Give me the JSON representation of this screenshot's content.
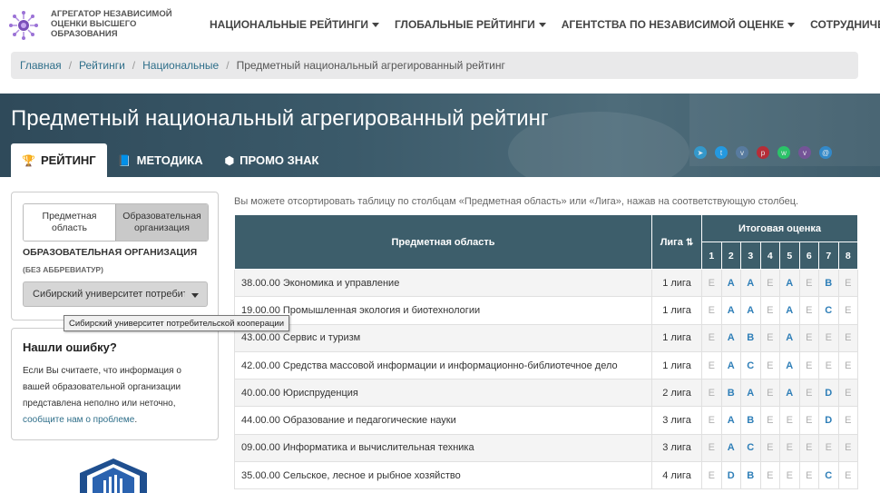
{
  "header": {
    "logo_text": "АГРЕГАТОР НЕЗАВИСИМОЙ ОЦЕНКИ ВЫСШЕГО ОБРАЗОВАНИЯ",
    "nav": [
      {
        "label": "НАЦИОНАЛЬНЫЕ РЕЙТИНГИ",
        "dropdown": true
      },
      {
        "label": "ГЛОБАЛЬНЫЕ РЕЙТИНГИ",
        "dropdown": true
      },
      {
        "label": "АГЕНТСТВА ПО НЕЗАВИСИМОЙ ОЦЕНКЕ",
        "dropdown": true
      },
      {
        "label": "СОТРУДНИЧЕСТВО",
        "dropdown": false
      }
    ]
  },
  "breadcrumb": {
    "items": [
      "Главная",
      "Рейтинги",
      "Национальные"
    ],
    "current": "Предметный национальный агрегированный рейтинг"
  },
  "hero": {
    "title": "Предметный национальный агрегированный рейтинг",
    "tabs": [
      {
        "label": "РЕЙТИНГ",
        "icon": "trophy-icon",
        "active": true
      },
      {
        "label": "МЕТОДИКА",
        "icon": "book-icon",
        "active": false
      },
      {
        "label": "ПРОМО ЗНАК",
        "icon": "badge-icon",
        "active": false
      }
    ],
    "socials": [
      {
        "name": "telegram-icon",
        "color": "#2fa0d8"
      },
      {
        "name": "twitter-icon",
        "color": "#1da1f2"
      },
      {
        "name": "vk-icon",
        "color": "#5a7ea6"
      },
      {
        "name": "pinterest-icon",
        "color": "#c8232c"
      },
      {
        "name": "whatsapp-icon",
        "color": "#25d366"
      },
      {
        "name": "viber-icon",
        "color": "#7b519d"
      },
      {
        "name": "email-icon",
        "color": "#2f8fd8"
      }
    ]
  },
  "filter": {
    "toggle_subject": "Предметная область",
    "toggle_org": "Образовательная организация",
    "org_label": "ОБРАЗОВАТЕЛЬНАЯ ОРГАНИЗАЦИЯ",
    "org_sublabel": "(БЕЗ АББРЕВИАТУР)",
    "selected_org": "Сибирский университет потребительской кооперации",
    "tooltip": "Сибирский университет потребительской кооперации"
  },
  "error_card": {
    "title": "Нашли ошибку?",
    "text": "Если Вы считаете, что информация о вашей образовательной организации представлена неполно или неточно,",
    "link": "сообщите нам о проблеме",
    "tail": "."
  },
  "table": {
    "hint": "Вы можете отсортировать таблицу по столбцам «Предметная область» или «Лига», нажав на соответствующую столбец.",
    "col_subject": "Предметная область",
    "col_league": "Лига",
    "col_total": "Итоговая оценка",
    "nums": [
      "1",
      "2",
      "3",
      "4",
      "5",
      "6",
      "7",
      "8"
    ],
    "rows": [
      {
        "subject": "38.00.00 Экономика и управление",
        "league": "1 лига",
        "grades": [
          "E",
          "A",
          "A",
          "E",
          "A",
          "E",
          "B",
          "E"
        ]
      },
      {
        "subject": "19.00.00 Промышленная экология и биотехнологии",
        "league": "1 лига",
        "grades": [
          "E",
          "A",
          "A",
          "E",
          "A",
          "E",
          "C",
          "E"
        ]
      },
      {
        "subject": "43.00.00 Сервис и туризм",
        "league": "1 лига",
        "grades": [
          "E",
          "A",
          "B",
          "E",
          "A",
          "E",
          "E",
          "E"
        ]
      },
      {
        "subject": "42.00.00 Средства массовой информации и информационно-библиотечное дело",
        "league": "1 лига",
        "grades": [
          "E",
          "A",
          "C",
          "E",
          "A",
          "E",
          "E",
          "E"
        ]
      },
      {
        "subject": "40.00.00 Юриспруденция",
        "league": "2 лига",
        "grades": [
          "E",
          "B",
          "A",
          "E",
          "A",
          "E",
          "D",
          "E"
        ]
      },
      {
        "subject": "44.00.00 Образование и педагогические науки",
        "league": "3 лига",
        "grades": [
          "E",
          "A",
          "B",
          "E",
          "E",
          "E",
          "D",
          "E"
        ]
      },
      {
        "subject": "09.00.00 Информатика и вычислительная техника",
        "league": "3 лига",
        "grades": [
          "E",
          "A",
          "C",
          "E",
          "E",
          "E",
          "E",
          "E"
        ]
      },
      {
        "subject": "35.00.00 Сельское, лесное и рыбное хозяйство",
        "league": "4 лига",
        "grades": [
          "E",
          "D",
          "B",
          "E",
          "E",
          "E",
          "C",
          "E"
        ]
      }
    ]
  }
}
